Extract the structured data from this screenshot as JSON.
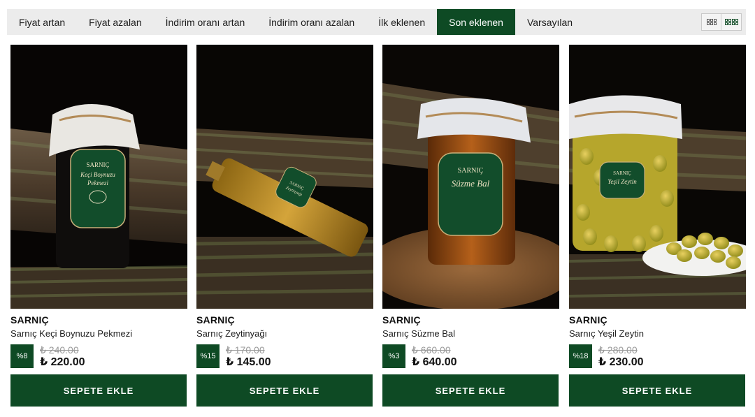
{
  "sort": {
    "options": [
      {
        "label": "Fiyat artan"
      },
      {
        "label": "Fiyat azalan"
      },
      {
        "label": "İndirim oranı artan"
      },
      {
        "label": "İndirim oranı azalan"
      },
      {
        "label": "İlk eklenen"
      },
      {
        "label": "Son eklenen",
        "active": true
      },
      {
        "label": "Varsayılan"
      }
    ],
    "views": [
      {
        "icon": "grid-3-icon"
      },
      {
        "icon": "grid-4-icon",
        "active": true
      }
    ]
  },
  "colors": {
    "primary": "#0e4a24",
    "bar": "#ececec",
    "old_price": "#9a9a9a"
  },
  "products": [
    {
      "brand": "SARNIÇ",
      "name": "Sarnıç Keçi Boynuzu Pekmezi",
      "discount": "%8",
      "old_price": "₺ 240.00",
      "new_price": "₺ 220.00",
      "button": "SEPETE EKLE",
      "label_lines": [
        "SARNIÇ",
        "Keçi Boynuzu",
        "Pekmezi"
      ]
    },
    {
      "brand": "SARNIÇ",
      "name": "Sarnıç Zeytinyağı",
      "discount": "%15",
      "old_price": "₺ 170.00",
      "new_price": "₺ 145.00",
      "button": "SEPETE EKLE",
      "label_lines": [
        "SARNIÇ",
        "Zeytinyağı"
      ]
    },
    {
      "brand": "SARNIÇ",
      "name": "Sarnıç Süzme Bal",
      "discount": "%3",
      "old_price": "₺ 660.00",
      "new_price": "₺ 640.00",
      "button": "SEPETE EKLE",
      "label_lines": [
        "SARNIÇ",
        "Süzme Bal"
      ]
    },
    {
      "brand": "SARNIÇ",
      "name": "Sarnıç Yeşil Zeytin",
      "discount": "%18",
      "old_price": "₺ 280.00",
      "new_price": "₺ 230.00",
      "button": "SEPETE EKLE",
      "label_lines": [
        "SARNIÇ",
        "Yeşil Zeytin"
      ]
    }
  ]
}
